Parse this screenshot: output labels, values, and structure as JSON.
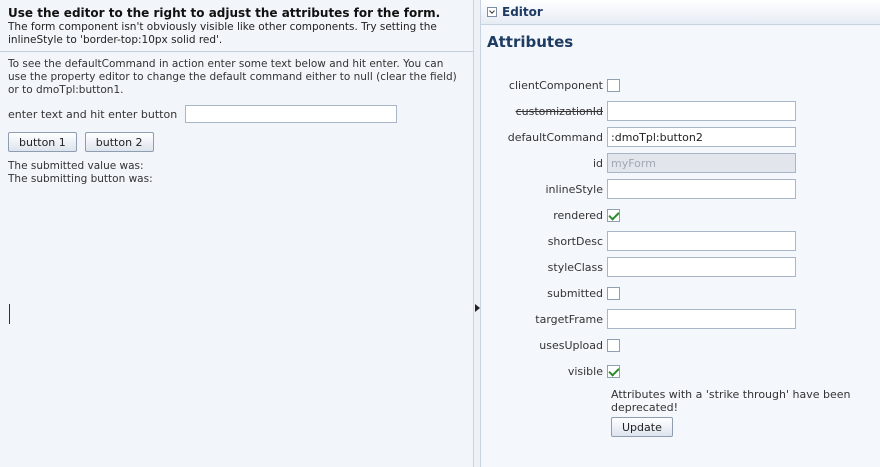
{
  "left": {
    "intro_title": "Use the editor to the right to adjust the attributes for the form.",
    "intro_text": "The form component isn't obviously visible like other components. Try setting the inlineStyle to 'border-top:10px solid red'.",
    "description": "To see the defaultCommand in action enter some text below and hit enter. You can use the property editor to change the default command either to null (clear the field) or to dmoTpl:button1.",
    "input_label": "enter text and hit enter button",
    "input_value": "",
    "button1_label": "button 1",
    "button2_label": "button 2",
    "submitted_value_label": "The submitted value was:",
    "submitting_button_label": "The submitting button was:"
  },
  "editor": {
    "title": "Editor",
    "attributes_heading": "Attributes",
    "attributes": [
      {
        "name": "clientComponent",
        "type": "checkbox",
        "checked": false
      },
      {
        "name": "customizationId",
        "type": "text",
        "value": "",
        "deprecated": true
      },
      {
        "name": "defaultCommand",
        "type": "text",
        "value": ":dmoTpl:button2"
      },
      {
        "name": "id",
        "type": "text",
        "value": "myForm",
        "disabled": true
      },
      {
        "name": "inlineStyle",
        "type": "text",
        "value": ""
      },
      {
        "name": "rendered",
        "type": "checkbox",
        "checked": true
      },
      {
        "name": "shortDesc",
        "type": "text",
        "value": ""
      },
      {
        "name": "styleClass",
        "type": "text",
        "value": ""
      },
      {
        "name": "submitted",
        "type": "checkbox",
        "checked": false
      },
      {
        "name": "targetFrame",
        "type": "text",
        "value": ""
      },
      {
        "name": "usesUpload",
        "type": "checkbox",
        "checked": false
      },
      {
        "name": "visible",
        "type": "checkbox",
        "checked": true
      }
    ],
    "deprecated_note": "Attributes with a 'strike through' have been deprecated!",
    "update_label": "Update"
  }
}
